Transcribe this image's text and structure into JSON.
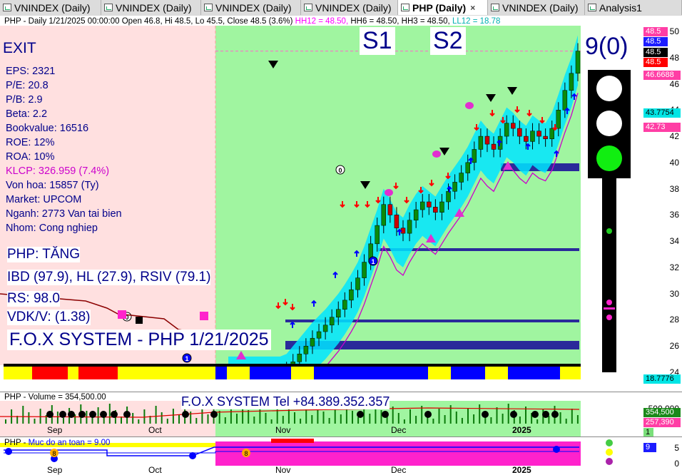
{
  "tabs": [
    {
      "label": "VNINDEX (Daily)",
      "active": false
    },
    {
      "label": "VNINDEX (Daily)",
      "active": false
    },
    {
      "label": "VNINDEX (Daily)",
      "active": false
    },
    {
      "label": "VNINDEX (Daily)",
      "active": false
    },
    {
      "label": "PHP (Daily)",
      "active": true
    },
    {
      "label": "VNINDEX (Daily)",
      "active": false
    },
    {
      "label": "Analysis1",
      "active": false
    }
  ],
  "tab_close": "×",
  "price_header": {
    "prefix": "PHP - Daily 1/21/2025 00:00:00 Open 46.8, Hi 48.5, Lo 45.5, Close 48.5 (3.6%)",
    "hh12": "HH12 = 48.50,",
    "hh6": "HH6 = 48.50,",
    "hh3": "HH3 = 48.50,",
    "ll12": "LL12 = 18.78"
  },
  "labels": {
    "exit": "EXIT",
    "s1": "S1",
    "s2": "S2",
    "count": "9(0)"
  },
  "fundamentals": [
    {
      "text": "EPS: 2321",
      "color": "#00008b"
    },
    {
      "text": "P/E: 20.8",
      "color": "#00008b"
    },
    {
      "text": "P/B: 2.9",
      "color": "#00008b"
    },
    {
      "text": "Beta: 2.2",
      "color": "#00008b"
    },
    {
      "text": "Bookvalue: 16516",
      "color": "#00008b"
    },
    {
      "text": "ROE: 12%",
      "color": "#00008b"
    },
    {
      "text": "ROA: 10%",
      "color": "#00008b"
    },
    {
      "text": "KLCP: 326.959 (7.4%)",
      "color": "#cc00cc"
    },
    {
      "text": "Von hoa: 15857 (Ty)",
      "color": "#00008b"
    },
    {
      "text": "Market: UPCOM",
      "color": "#00008b"
    },
    {
      "text": "Nganh: 2773 Van tai bien",
      "color": "#00008b"
    },
    {
      "text": "Nhom: Cong nghiep",
      "color": "#00008b"
    }
  ],
  "signals": {
    "trend": "PHP: TĂNG",
    "ibd": "IBD (97.9), HL (27.9), RSIV (79.1)",
    "rs": "RS: 98.0",
    "vdk": "VDK/V:  (1.38)"
  },
  "system_title": "F.O.X SYSTEM - PHP 1/21/2025",
  "system_tel": "F.O.X SYSTEM Tel +84.389.352.357",
  "price_axis": {
    "ticks": [
      "50",
      "48",
      "46",
      "44",
      "42",
      "40",
      "38",
      "36",
      "34",
      "32",
      "30",
      "28",
      "26",
      "24"
    ],
    "badges": [
      {
        "text": "48.5",
        "bg": "#ff3ea5",
        "fg": "#ffffff"
      },
      {
        "text": "48.5",
        "bg": "#1c1cff",
        "fg": "#ffffff"
      },
      {
        "text": "48.5",
        "bg": "#000000",
        "fg": "#ffffff"
      },
      {
        "text": "48.5",
        "bg": "#ff0000",
        "fg": "#ffffff"
      },
      {
        "text": "46.6688",
        "bg": "#ff3ea5",
        "fg": "#ffffff"
      },
      {
        "text": "43.7754",
        "bg": "#00e5e5",
        "fg": "#000000"
      },
      {
        "text": "42.73",
        "bg": "#ff3ea5",
        "fg": "#ffffff"
      },
      {
        "text": "18.7776",
        "bg": "#00e5e5",
        "fg": "#000000"
      }
    ]
  },
  "x_axis": {
    "price_months": [
      "Sep",
      "Oct",
      "Nov",
      "Dec",
      "2025"
    ],
    "volume_months": [
      "Sep",
      "Oct",
      "Nov",
      "Dec",
      "2025"
    ],
    "safety_months": [
      "Sep",
      "Oct",
      "Nov",
      "Dec",
      "2025"
    ]
  },
  "volume_pane": {
    "header": "PHP - Volume = 354,500.00",
    "ticks": [
      "500,000"
    ],
    "badges": [
      {
        "text": "354,500",
        "bg": "#1a8a1a",
        "fg": "#ffffff"
      },
      {
        "text": "257,390",
        "bg": "#ff3ea5",
        "fg": "#ffffff"
      },
      {
        "text": "1",
        "bg": "#7be07b",
        "fg": "#000000"
      }
    ]
  },
  "safety_pane": {
    "header_prefix": "PHP - ",
    "header_value": "Muc do an toan = 9.00",
    "ticks": [
      "5",
      "0"
    ],
    "badge": {
      "text": "9",
      "bg": "#1c1cff",
      "fg": "#ffffff"
    }
  },
  "markers": {
    "o": "0",
    "one": "1",
    "eight": "8",
    "nine": "9"
  },
  "chart_data": {
    "type": "candlestick",
    "symbol": "PHP",
    "last_bar": {
      "date": "1/21/2025",
      "open": 46.8,
      "high": 48.5,
      "low": 45.5,
      "close": 48.5,
      "change_pct": 3.6
    },
    "ylim": [
      24,
      50
    ],
    "close_series": [
      18.8,
      19.2,
      19.8,
      20.4,
      21.0,
      21.6,
      22.3,
      23.0,
      23.6,
      24.2,
      24.8,
      25.4,
      26.0,
      26.6,
      27.1,
      27.6,
      28.2,
      28.8,
      29.5,
      30.3,
      31.2,
      32.4,
      33.8,
      35.2,
      36.8,
      36.0,
      35.0,
      34.6,
      35.6,
      36.4,
      37.0,
      36.6,
      36.2,
      37.0,
      37.8,
      38.5,
      39.2,
      40.0,
      41.0,
      42.0,
      41.4,
      41.0,
      42.0,
      43.0,
      42.6,
      42.0,
      41.6,
      42.4,
      42.0,
      41.8,
      42.6,
      44.0,
      45.5,
      46.8,
      48.5
    ],
    "volume_last": 354500,
    "volume_ma": 257390,
    "safety_level": 9
  }
}
